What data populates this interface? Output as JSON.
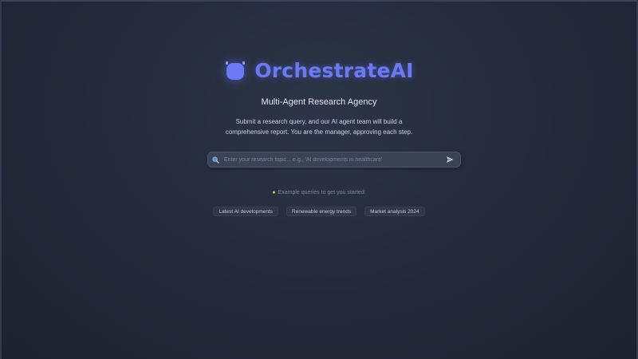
{
  "brand": {
    "name": "OrchestrateAI",
    "icon": "robot-head-icon",
    "accent_color": "#6a79f5"
  },
  "hero": {
    "subtitle": "Multi-Agent Research Agency",
    "description": "Submit a research query, and our AI agent team will build a comprehensive report. You are the manager, approving each step."
  },
  "search": {
    "icon": "search-icon",
    "placeholder": "Enter your research topic... e.g., 'AI developments in healthcare'",
    "value": "",
    "send_icon": "send-arrow-icon"
  },
  "examples": {
    "hint_icon": "lightbulb-icon",
    "hint": "Example queries to get you started:",
    "items": [
      {
        "label": "Latest AI developments"
      },
      {
        "label": "Renewable energy trends"
      },
      {
        "label": "Market analysis 2024"
      }
    ]
  },
  "colors": {
    "background": "#222a39",
    "search_bg": "#3a4354",
    "chip_bg": "#2f3748"
  }
}
